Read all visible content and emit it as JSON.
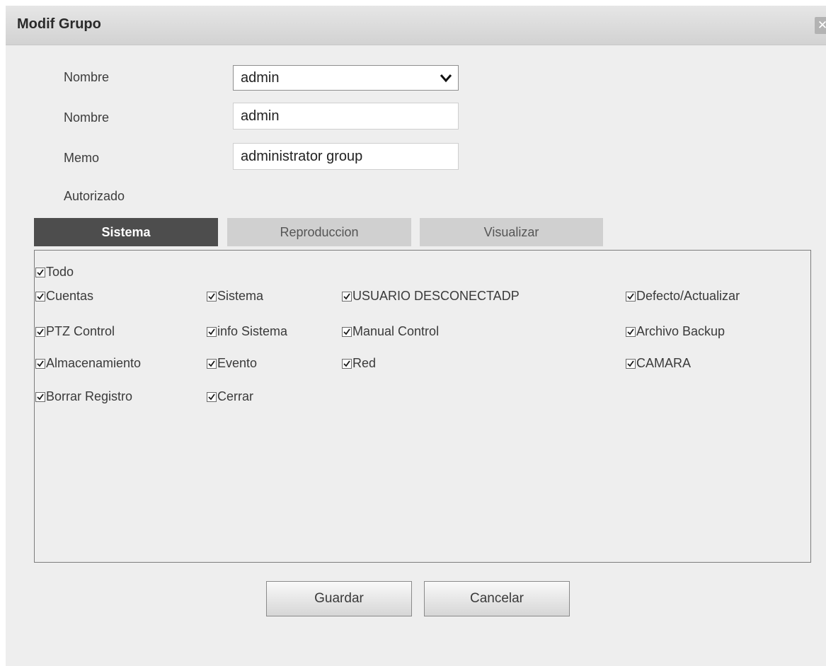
{
  "dialog": {
    "title": "Modif Grupo",
    "close_glyph": "✕"
  },
  "form": {
    "group_select_label": "Nombre",
    "group_select_value": "admin",
    "name_label": "Nombre",
    "name_value": "admin",
    "memo_label": "Memo",
    "memo_value": "administrator group",
    "authorized_label": "Autorizado"
  },
  "tabs": [
    {
      "label": "Sistema",
      "active": true
    },
    {
      "label": "Reproduccion",
      "active": false
    },
    {
      "label": "Visualizar",
      "active": false
    }
  ],
  "permissions": {
    "all": {
      "label": "Todo",
      "checked": true
    },
    "items": [
      {
        "label": "Cuentas",
        "checked": true
      },
      {
        "label": "Sistema",
        "checked": true
      },
      {
        "label": "USUARIO DESCONECTADP",
        "checked": true
      },
      {
        "label": "Defecto/Actualizar",
        "checked": true
      },
      {
        "label": "PTZ Control",
        "checked": true
      },
      {
        "label": "info Sistema",
        "checked": true
      },
      {
        "label": "Manual Control",
        "checked": true
      },
      {
        "label": "Archivo Backup",
        "checked": true
      },
      {
        "label": "Almacenamiento",
        "checked": true
      },
      {
        "label": "Evento",
        "checked": true
      },
      {
        "label": "Red",
        "checked": true
      },
      {
        "label": "CAMARA",
        "checked": true
      },
      {
        "label": "Borrar Registro",
        "checked": true
      },
      {
        "label": "Cerrar",
        "checked": true
      }
    ]
  },
  "buttons": {
    "save_label": "Guardar",
    "cancel_label": "Cancelar"
  },
  "icons": {
    "checkbox": "check-icon",
    "dropdown": "chevron-down-icon",
    "close": "close-icon"
  },
  "colors": {
    "active_tab": "#4d4d4d",
    "inactive_tab": "#d0d0d0",
    "dialog_bg": "#eeeeee"
  }
}
